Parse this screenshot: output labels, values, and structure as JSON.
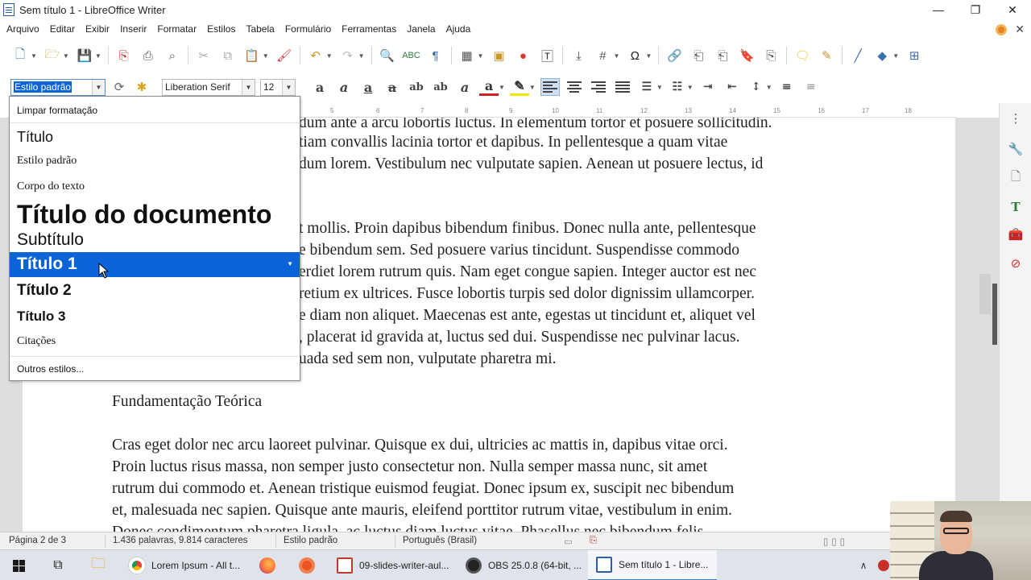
{
  "window": {
    "title": "Sem título 1 - LibreOffice Writer",
    "controls": [
      "—",
      "❐",
      "✕"
    ]
  },
  "menu": [
    "Arquivo",
    "Editar",
    "Exibir",
    "Inserir",
    "Formatar",
    "Estilos",
    "Tabela",
    "Formulário",
    "Ferramentas",
    "Janela",
    "Ajuda"
  ],
  "toolbar2": {
    "style_value": "Estilo padrão",
    "font_value": "Liberation Serif",
    "size_value": "12"
  },
  "ruler": [
    "5",
    "6",
    "7",
    "8",
    "9",
    "10",
    "11",
    "12",
    "13",
    "14",
    "15",
    "16",
    "17",
    "18"
  ],
  "style_dropdown": {
    "clear": "Limpar formatação",
    "items": [
      {
        "label": "Título"
      },
      {
        "label": "Estilo padrão"
      },
      {
        "label": "Corpo do texto"
      },
      {
        "label": "Título do documento"
      },
      {
        "label": "Subtítulo"
      },
      {
        "label": "Título 1"
      },
      {
        "label": "Título 2"
      },
      {
        "label": "Título 3"
      },
      {
        "label": "Citações"
      }
    ],
    "more": "Outros estilos..."
  },
  "document": {
    "para1": [
      "dum ante a arcu lobortis luctus. In elementum tortor et posuere sollicitudin.",
      "tiam convallis lacinia tortor et dapibus. In pellentesque a quam vitae",
      "dum lorem. Vestibulum nec vulputate sapien. Aenean ut posuere lectus, id"
    ],
    "para2": [
      "t mollis. Proin dapibus bibendum finibus. Donec nulla ante, pellentesque",
      "e bibendum sem. Sed posuere varius tincidunt. Suspendisse commodo",
      "erdiet lorem rutrum quis. Nam eget congue sapien. Integer auctor est nec",
      "retium ex ultrices. Fusce lobortis turpis sed dolor dignissim ullamcorper.",
      "e diam non aliquet. Maecenas est ante, egestas ut tincidunt et, aliquet vel",
      ", placerat id gravida at, luctus sed dui. Suspendisse nec pulvinar lacus.",
      "uada sed sem non, vulputate pharetra mi."
    ],
    "heading": "Fundamentação Teórica",
    "para3": [
      "Cras eget dolor nec arcu laoreet pulvinar. Quisque ex dui, ultricies ac mattis in, dapibus vitae orci.",
      "Proin luctus risus massa, non semper justo consectetur non. Nulla semper massa nunc, sit amet",
      "rutrum dui commodo et. Aenean tristique euismod feugiat. Donec ipsum ex, suscipit nec bibendum",
      "et, malesuada nec sapien. Quisque ante mauris, eleifend porttitor rutrum vitae, vestibulum in enim.",
      "Donec condimentum pharetra ligula, ac luctus diam luctus vitae. Phasellus nec bibendum felis."
    ]
  },
  "status": {
    "page": "Página 2 de 3",
    "words": "1.436 palavras, 9.814 caracteres",
    "style": "Estilo padrão",
    "language": "Português (Brasil)"
  },
  "taskbar": {
    "apps": [
      {
        "label": "Lorem Ipsum - All t..."
      },
      {
        "label": "09-slides-writer-aul..."
      },
      {
        "label": "OBS 25.0.8 (64-bit, ..."
      },
      {
        "label": "Sem título 1 - Libre..."
      }
    ]
  },
  "colors": {
    "selection": "#0a64d8",
    "accent": "#3a6fb0"
  }
}
